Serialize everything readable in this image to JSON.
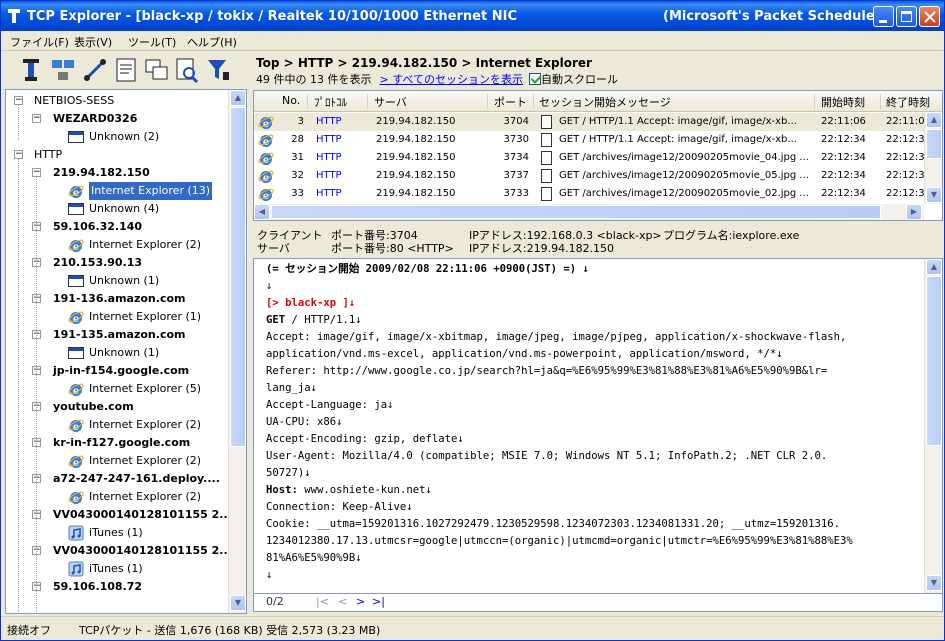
{
  "window": {
    "title_left": "TCP Explorer - [black-xp / tokix  / Realtek 10/100/1000 Ethernet NIC",
    "title_right": "(Microsoft's Packet Schedule..."
  },
  "menu": {
    "file": "ファイル(F)",
    "view": "表示(V)",
    "tools": "ツール(T)",
    "help": "ヘルプ(H)"
  },
  "toolbar": {
    "icons": [
      "network-capture-icon",
      "packet-icon",
      "connect-icon",
      "log-icon",
      "window-icon",
      "find-icon",
      "filter-icon"
    ]
  },
  "tree": {
    "groups": [
      {
        "label": "NETBIOS-SESS"
      },
      {
        "label": "HTTP"
      }
    ],
    "hosts": [
      {
        "label": "WEZARD0326",
        "children": [
          {
            "label": "Unknown (2)",
            "type": "unknown"
          }
        ]
      },
      {
        "label": "219.94.182.150",
        "children": [
          {
            "label": "Internet Explorer (13)",
            "type": "ie",
            "selected": true
          },
          {
            "label": "Unknown (4)",
            "type": "unknown"
          }
        ]
      },
      {
        "label": "59.106.32.140",
        "children": [
          {
            "label": "Internet Explorer (2)",
            "type": "ie"
          }
        ]
      },
      {
        "label": "210.153.90.13",
        "children": [
          {
            "label": "Unknown (1)",
            "type": "unknown"
          }
        ]
      },
      {
        "label": "191-136.amazon.com",
        "children": [
          {
            "label": "Internet Explorer (1)",
            "type": "ie"
          }
        ]
      },
      {
        "label": "191-135.amazon.com",
        "children": [
          {
            "label": "Unknown (1)",
            "type": "unknown"
          }
        ]
      },
      {
        "label": "jp-in-f154.google.com",
        "children": [
          {
            "label": "Internet Explorer (5)",
            "type": "ie"
          }
        ]
      },
      {
        "label": "youtube.com",
        "children": [
          {
            "label": "Internet Explorer (2)",
            "type": "ie"
          }
        ]
      },
      {
        "label": "kr-in-f127.google.com",
        "children": [
          {
            "label": "Internet Explorer (2)",
            "type": "ie"
          }
        ]
      },
      {
        "label": "a72-247-247-161.deploy....",
        "children": [
          {
            "label": "Internet Explorer (2)",
            "type": "ie"
          }
        ]
      },
      {
        "label": "VV043000140128101155 2...",
        "children": [
          {
            "label": "iTunes (1)",
            "type": "itunes"
          }
        ]
      },
      {
        "label": "VV043000140128101155 2...",
        "children": [
          {
            "label": "iTunes (1)",
            "type": "itunes"
          }
        ]
      },
      {
        "label": "59.106.108.72",
        "children": []
      }
    ]
  },
  "header": {
    "breadcrumb": "Top > HTTP > 219.94.182.150 > Internet Explorer",
    "count": "49 件中の 13 件を表示",
    "show_all": "> すべてのセッションを表示",
    "autoscroll": "自動スクロール"
  },
  "table": {
    "columns": [
      "No.",
      "ﾌﾟﾛﾄｺﾙ",
      "サーバ",
      "ポート",
      "セッション開始メッセージ",
      "開始時刻",
      "終了時刻"
    ],
    "rows": [
      {
        "no": "3",
        "proto": "HTTP",
        "server": "219.94.182.150",
        "port": "3704",
        "msg": "GET / HTTP/1.1 Accept: image/gif, image/x-xb...",
        "start": "22:11:06",
        "end": "22:11:0"
      },
      {
        "no": "28",
        "proto": "HTTP",
        "server": "219.94.182.150",
        "port": "3730",
        "msg": "GET / HTTP/1.1 Accept: image/gif, image/x-xb...",
        "start": "22:12:34",
        "end": "22:12:3"
      },
      {
        "no": "31",
        "proto": "HTTP",
        "server": "219.94.182.150",
        "port": "3734",
        "msg": "GET /archives/image12/20090205movie_04.jpg ...",
        "start": "22:12:34",
        "end": "22:12:3"
      },
      {
        "no": "32",
        "proto": "HTTP",
        "server": "219.94.182.150",
        "port": "3737",
        "msg": "GET /archives/image12/20090205movie_05.jpg ...",
        "start": "22:12:34",
        "end": "22:12:3"
      },
      {
        "no": "33",
        "proto": "HTTP",
        "server": "219.94.182.150",
        "port": "3733",
        "msg": "GET /archives/image12/20090205movie_02.jpg ...",
        "start": "22:12:34",
        "end": "22:12:3"
      }
    ]
  },
  "info": {
    "client_label": "クライアント",
    "client_port": "ポート番号:3704",
    "client_ip": "IPアドレス:192.168.0.3 <black-xp>",
    "program": "プログラム名:iexplore.exe",
    "server_label": "サーバ",
    "server_port": "ポート番号:80 <HTTP>",
    "server_ip": "IPアドレス:219.94.182.150"
  },
  "content": {
    "session_start": "(= セッション開始 2009/02/08 22:11:06 +0900(JST) =) ↓",
    "arrow": "↓",
    "client_tag": "[> black-xp ]↓",
    "request_method": "GET",
    "request_rest": " / HTTP/1.1↓",
    "accept1": "Accept: image/gif, image/x-xbitmap, image/jpeg, image/pjpeg, application/x-shockwave-flash,",
    "accept2": "application/vnd.ms-excel, application/vnd.ms-powerpoint, application/msword, */*↓",
    "referer1": "Referer: http://www.google.co.jp/search?hl=ja&q=%E6%95%99%E3%81%88%E3%81%A6%E5%90%9B&lr=",
    "referer2": "lang_ja↓",
    "accept_lang": "Accept-Language: ja↓",
    "ua_cpu": "UA-CPU: x86↓",
    "accept_enc": "Accept-Encoding: gzip, deflate↓",
    "ua1": "User-Agent: Mozilla/4.0 (compatible; MSIE 7.0; Windows NT 5.1; InfoPath.2; .NET CLR 2.0.",
    "ua2": "50727)↓",
    "host_key": "Host:",
    "host_val": " www.oshiete-kun.net↓",
    "connection": "Connection: Keep-Alive↓",
    "cookie1": "Cookie: __utma=159201316.1027292479.1230529598.1234072303.1234081331.20; __utmz=159201316.",
    "cookie2": "1234012380.17.13.utmcsr=google|utmccn=(organic)|utmcmd=organic|utmctr=%E6%95%99%E3%81%88%E3%",
    "cookie3": "81%A6%E5%90%9B↓",
    "end_arrow": "↓"
  },
  "pager": {
    "page": "0/2",
    "first": "|<",
    "prev": "<",
    "next": ">",
    "last": ">|"
  },
  "status": {
    "connection": "接続オフ",
    "traffic": "TCPパケット - 送信 1,676 (168 KB)  受信 2,573 (3.23 MB)"
  },
  "colors": {
    "title_blue": "#0a5ce0",
    "selection": "#316ac5",
    "link": "#0000ff",
    "accent_red": "#e00000"
  }
}
